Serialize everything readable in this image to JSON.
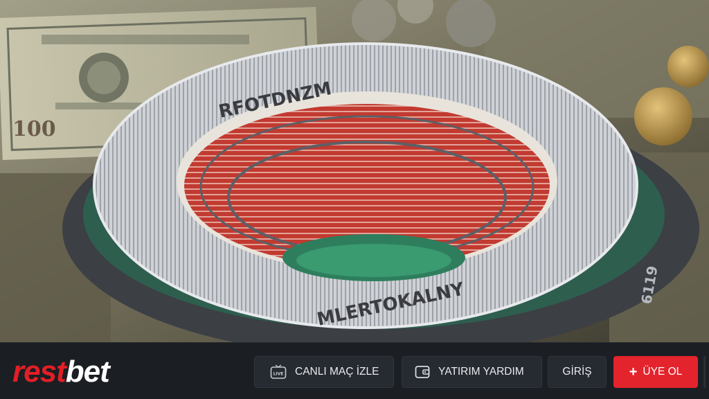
{
  "hero": {
    "banknote_text": "100",
    "stadium_top_text": "RFOTDNZM",
    "stadium_bottom_text": "MLERTOKALNY",
    "stadium_side_text": "6119"
  },
  "header": {
    "logo_part1": "rest",
    "logo_part2": "bet",
    "live_label": "CANLI MAÇ İZLE",
    "deposit_label": "YATIRIM YARDIM",
    "login_label": "GİRİŞ",
    "register_label": "ÜYE OL",
    "icons": [
      "live-tv-icon",
      "wallet-icon",
      "plus-icon"
    ]
  },
  "colors": {
    "brand_red": "#e31e26",
    "bar_bg": "#1b1e23",
    "button_dark": "#262a31"
  }
}
